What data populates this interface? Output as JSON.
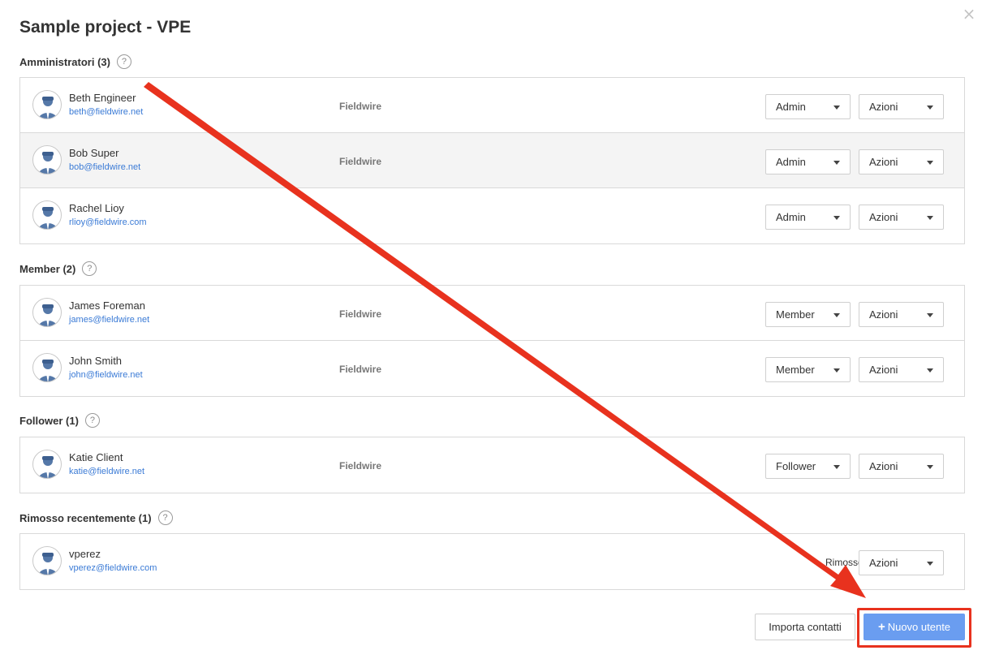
{
  "title": "Sample project - VPE",
  "close_icon": "close-icon",
  "help_glyph": "?",
  "sections": [
    {
      "label": "Amministratori (3)",
      "users": [
        {
          "name": "Beth Engineer",
          "email": "beth@fieldwire.net",
          "company": "Fieldwire",
          "role": "Admin",
          "actions": "Azioni"
        },
        {
          "name": "Bob Super",
          "email": "bob@fieldwire.net",
          "company": "Fieldwire",
          "role": "Admin",
          "actions": "Azioni"
        },
        {
          "name": "Rachel Lioy",
          "email": "rlioy@fieldwire.com",
          "company": "",
          "role": "Admin",
          "actions": "Azioni"
        }
      ]
    },
    {
      "label": "Member (2)",
      "users": [
        {
          "name": "James Foreman",
          "email": "james@fieldwire.net",
          "company": "Fieldwire",
          "role": "Member",
          "actions": "Azioni"
        },
        {
          "name": "John Smith",
          "email": "john@fieldwire.net",
          "company": "Fieldwire",
          "role": "Member",
          "actions": "Azioni"
        }
      ]
    },
    {
      "label": "Follower (1)",
      "users": [
        {
          "name": "Katie Client",
          "email": "katie@fieldwire.net",
          "company": "Fieldwire",
          "role": "Follower",
          "actions": "Azioni"
        }
      ]
    },
    {
      "label": "Rimosso recentemente (1)",
      "users": [
        {
          "name": "vperez",
          "email": "vperez@fieldwire.com",
          "status": "Rimosso",
          "actions": "Azioni"
        }
      ]
    }
  ],
  "footer": {
    "import_label": "Importa contatti",
    "new_user_plus": "+",
    "new_user_label": "Nuovo utente"
  },
  "colors": {
    "accent": "#6a9df0",
    "link": "#3b7bd6",
    "annotation": "#e8321e"
  }
}
